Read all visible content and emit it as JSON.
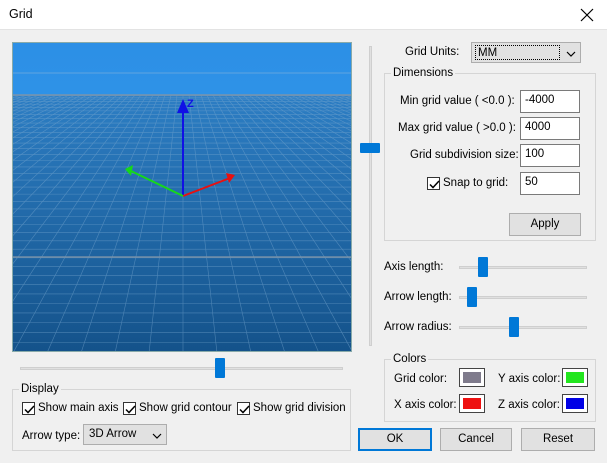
{
  "window": {
    "title": "Grid"
  },
  "grid_units": {
    "label": "Grid Units:",
    "value": "MM"
  },
  "dimensions": {
    "legend": "Dimensions",
    "min_label": "Min grid value ( <0.0 ):",
    "min_value": "-4000",
    "max_label": "Max grid value ( >0.0 ):",
    "max_value": "4000",
    "subdiv_label": "Grid subdivision size:",
    "subdiv_value": "100",
    "snap_label": "Snap to grid:",
    "snap_value": "50",
    "snap_checked": true,
    "apply_label": "Apply"
  },
  "axis": {
    "axis_length_label": "Axis length:",
    "arrow_length_label": "Arrow length:",
    "arrow_radius_label": "Arrow radius:"
  },
  "colors": {
    "legend": "Colors",
    "grid_label": "Grid color:",
    "grid_color": "#7f7b8c",
    "y_label": "Y axis color:",
    "y_color": "#22e61e",
    "x_label": "X axis color:",
    "x_color": "#ee1111",
    "z_label": "Z axis color:",
    "z_color": "#0000e6"
  },
  "display": {
    "legend": "Display",
    "show_main_axis": "Show main axis",
    "show_grid_contour": "Show grid contour",
    "show_grid_division": "Show grid division",
    "arrow_type_label": "Arrow type:",
    "arrow_type_value": "3D Arrow"
  },
  "viewport": {
    "z_label": "Z"
  },
  "buttons": {
    "ok": "OK",
    "cancel": "Cancel",
    "reset": "Reset"
  },
  "sliders": {
    "axis_length": 0.19,
    "arrow_length": 0.1,
    "arrow_radius": 0.43,
    "horizontal": 0.62,
    "vertical": 0.34
  }
}
